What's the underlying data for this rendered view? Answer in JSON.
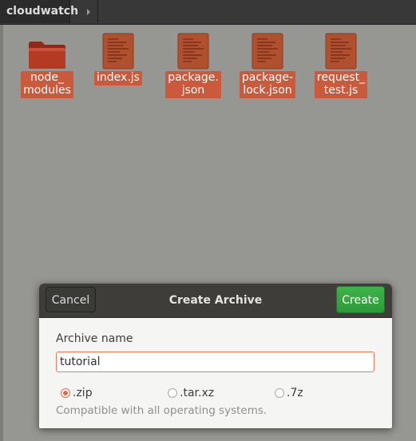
{
  "window": {
    "path_button": "cloudwatch",
    "path_next_icon": "chevron-right-icon"
  },
  "files": [
    {
      "name": "node_\nmodules",
      "type": "folder"
    },
    {
      "name": "index.js",
      "type": "text-file"
    },
    {
      "name": "package.\njson",
      "type": "text-file"
    },
    {
      "name": "package-\nlock.json",
      "type": "text-file"
    },
    {
      "name": "request_\ntest.js",
      "type": "text-file"
    }
  ],
  "dialog": {
    "title": "Create Archive",
    "cancel_label": "Cancel",
    "create_label": "Create",
    "name_label": "Archive name",
    "name_value": "tutorial",
    "formats": [
      {
        "label": ".zip",
        "selected": true
      },
      {
        "label": ".tar.xz",
        "selected": false
      },
      {
        "label": ".7z",
        "selected": false
      }
    ],
    "hint": "Compatible with all operating systems."
  },
  "colors": {
    "selection": "#c95a3b",
    "accent": "#e06b47",
    "create_button": "#3aab46"
  }
}
